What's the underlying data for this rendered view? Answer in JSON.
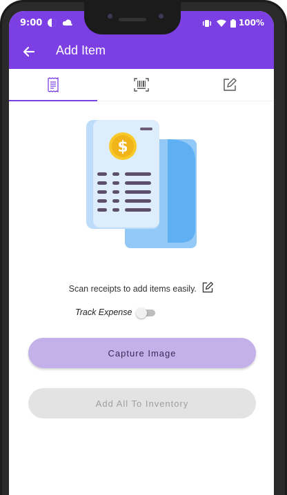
{
  "status_bar": {
    "time": "9:00",
    "battery": "100%",
    "left_icons": [
      "privacy-dot-icon",
      "cloud-icon"
    ],
    "right_icons": [
      "vibrate-icon",
      "wifi-icon",
      "battery-icon"
    ]
  },
  "app_bar": {
    "title": "Add Item",
    "background_color": "#7b3fe4",
    "back_icon": "arrow-left-icon"
  },
  "tabs": [
    {
      "icon": "receipt-icon",
      "selected": true
    },
    {
      "icon": "barcode-scan-icon",
      "selected": false
    },
    {
      "icon": "edit-icon",
      "selected": false
    }
  ],
  "illustration": {
    "icon": "receipt-dollar-illustration"
  },
  "description": {
    "text": "Scan receipts to add items easily.",
    "icon": "edit-icon"
  },
  "track_expense": {
    "label": "Track Expense",
    "enabled": false
  },
  "buttons": {
    "capture": "Capture Image",
    "add_all": "Add All To Inventory"
  },
  "colors": {
    "accent": "#7b3fe4",
    "capture_button": "#c4b1ea",
    "disabled_button": "#e3e3e3"
  }
}
